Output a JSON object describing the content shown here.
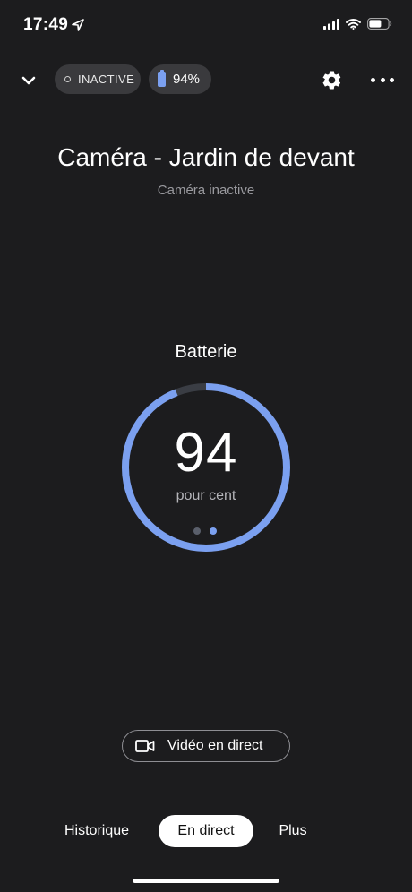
{
  "status_bar": {
    "time": "17:49",
    "icons": [
      "location-arrow-icon",
      "signal-icon",
      "wifi-icon",
      "battery-icon"
    ]
  },
  "header": {
    "status_pill": "INACTIVE",
    "battery_pill": "94%",
    "battery_level": 0.94,
    "icons": [
      "chevron-down-icon",
      "gear-icon",
      "more-icon"
    ]
  },
  "device": {
    "title": "Caméra - Jardin de devant",
    "subtitle": "Caméra inactive"
  },
  "battery_gauge": {
    "label": "Batterie",
    "value": "94",
    "unit": "pour cent",
    "fraction": 0.94,
    "page_count": 2,
    "active_page": 2
  },
  "live_button": {
    "label": "Vidéo en direct"
  },
  "tabs": [
    {
      "label": "Historique",
      "active": false
    },
    {
      "label": "En direct",
      "active": true
    },
    {
      "label": "Plus",
      "active": false
    }
  ],
  "colors": {
    "background": "#1c1c1e",
    "accent": "#7ba0f0",
    "pill": "#3a3a3d"
  }
}
